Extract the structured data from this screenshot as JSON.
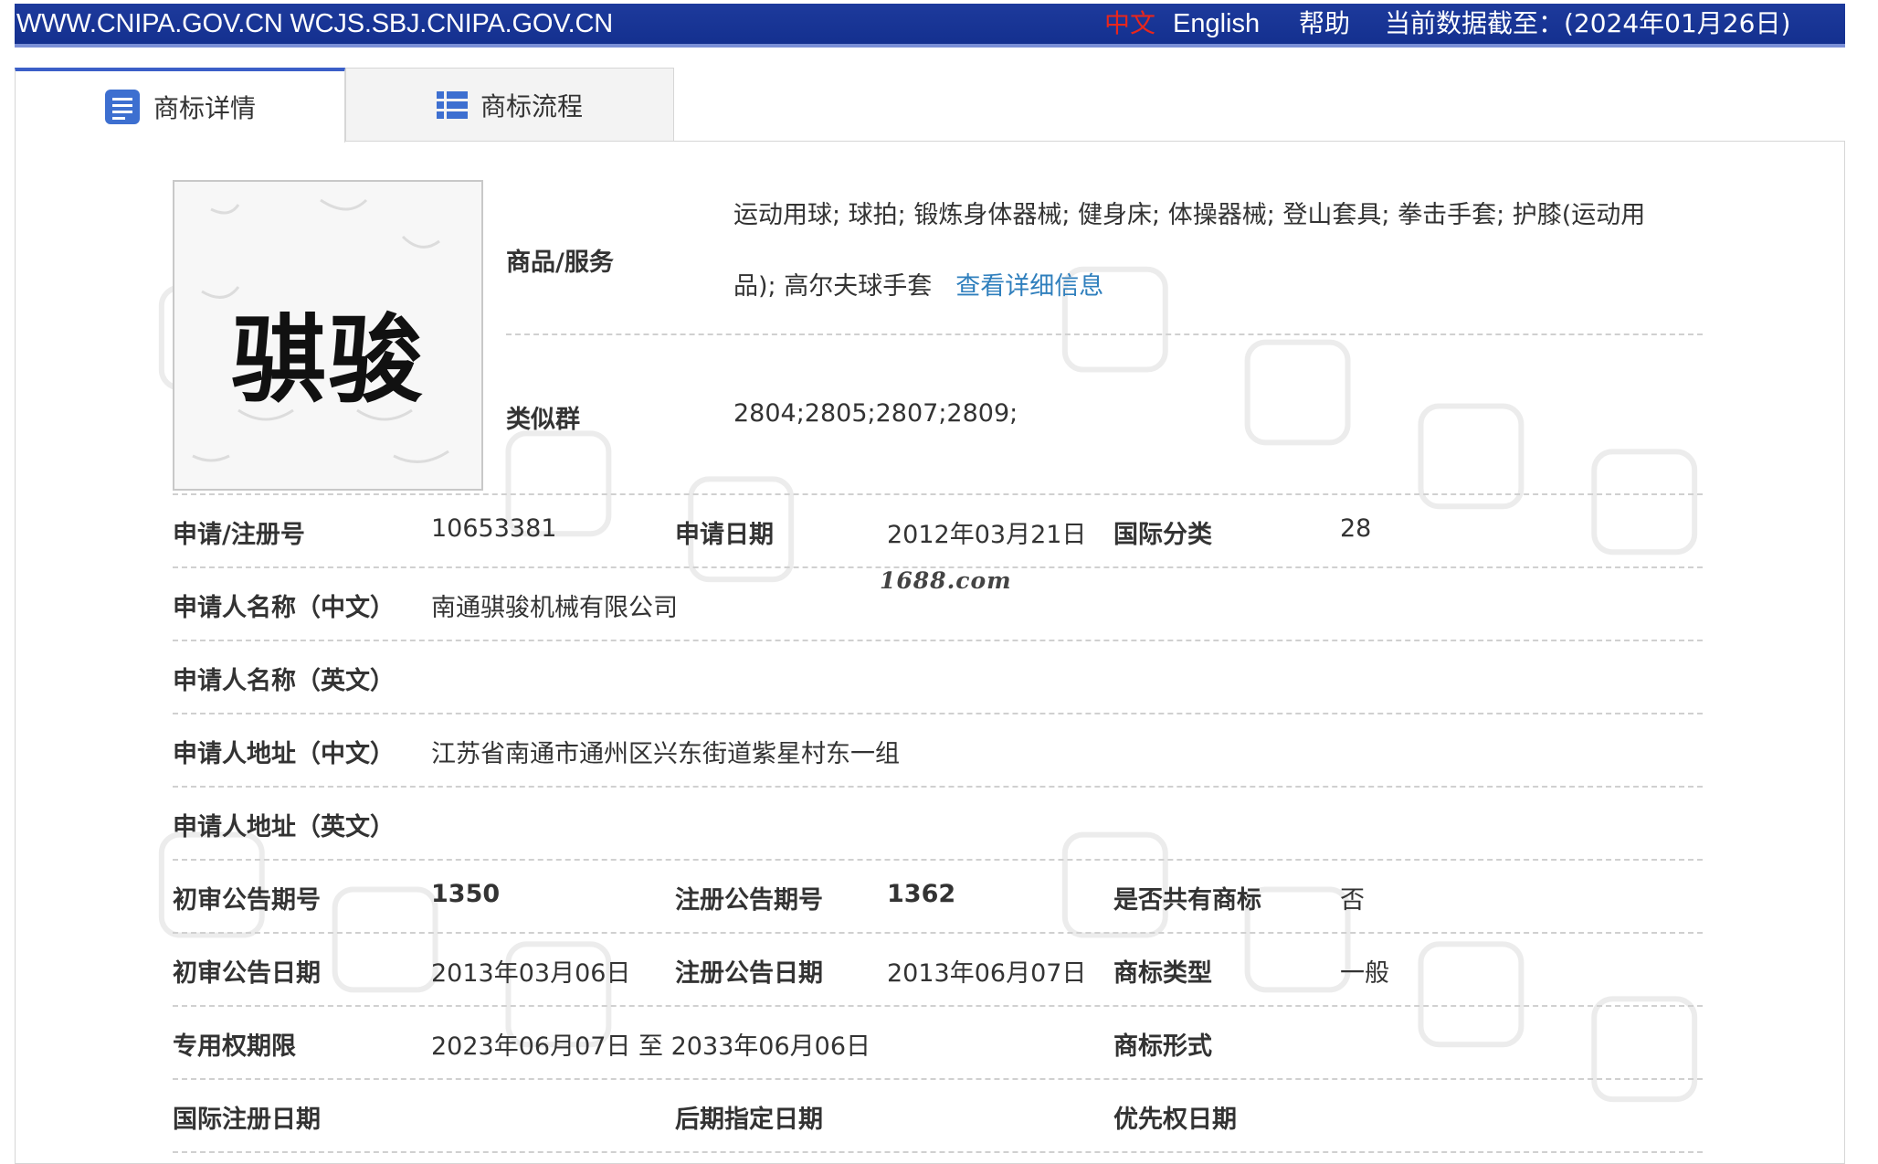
{
  "topbar": {
    "sites": "WWW.CNIPA.GOV.CN WCJS.SBJ.CNIPA.GOV.CN",
    "lang_zh": "中文",
    "lang_en": "English",
    "help": "帮助",
    "data_as_of": "当前数据截至：(2024年01月26日)"
  },
  "tabs": [
    {
      "label": "商标详情",
      "icon": "document-list-icon",
      "active": true
    },
    {
      "label": "商标流程",
      "icon": "list-icon",
      "active": false
    }
  ],
  "trademark": {
    "image_text": "骐骏",
    "goods_label": "商品/服务",
    "goods_value": "运动用球; 球拍; 锻炼身体器械; 健身床; 体操器械; 登山套具; 拳击手套; 护膝(运动用品); 高尔夫球手套",
    "detail_link": "查看详细信息",
    "similar_group_label": "类似群",
    "similar_group_value": "2804;2805;2807;2809;"
  },
  "fields": {
    "reg_no_label": "申请/注册号",
    "reg_no_value": "10653381",
    "app_date_label": "申请日期",
    "app_date_value": "2012年03月21日",
    "intl_class_label": "国际分类",
    "intl_class_value": "28",
    "applicant_cn_label": "申请人名称（中文）",
    "applicant_cn_value": "南通骐骏机械有限公司",
    "applicant_en_label": "申请人名称（英文）",
    "address_cn_label": "申请人地址（中文）",
    "address_cn_value": "江苏省南通市通州区兴东街道紫星村东一组",
    "address_en_label": "申请人地址（英文）",
    "prelim_issue_label": "初审公告期号",
    "prelim_issue_value": "1350",
    "reg_issue_label": "注册公告期号",
    "reg_issue_value": "1362",
    "shared_label": "是否共有商标",
    "shared_value": "否",
    "prelim_date_label": "初审公告日期",
    "prelim_date_value": "2013年03月06日",
    "reg_date_label": "注册公告日期",
    "reg_date_value": "2013年06月07日",
    "tm_type_label": "商标类型",
    "tm_type_value": "一般",
    "exclusive_period_label": "专用权期限",
    "exclusive_period_value": "2023年06月07日 至 2033年06月06日",
    "tm_form_label": "商标形式",
    "intl_reg_date_label": "国际注册日期",
    "later_designation_label": "后期指定日期",
    "priority_date_label": "优先权日期"
  },
  "source_watermark": "1688.com",
  "colors": {
    "topbar": "#1d3a9c",
    "lang_active": "#e8261c",
    "link": "#2f7fbd",
    "tab_accent": "#3b5fc8"
  }
}
